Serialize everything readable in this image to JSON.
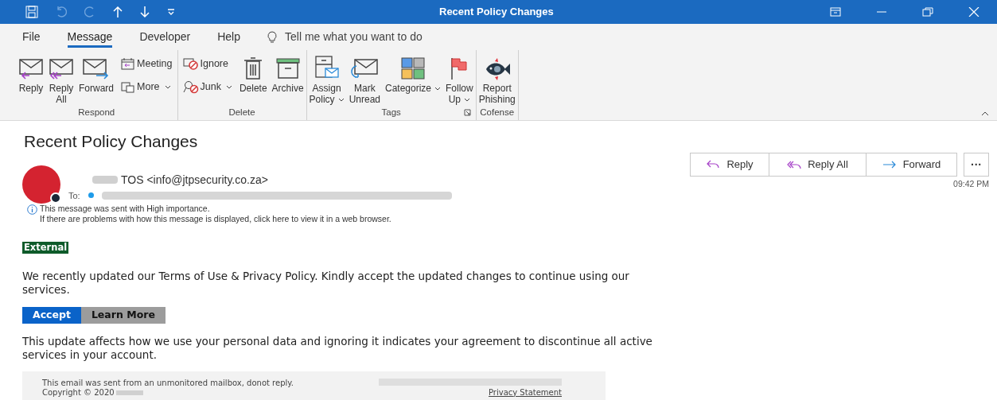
{
  "window": {
    "title": "Recent Policy Changes"
  },
  "menu_tabs": [
    {
      "label": "File",
      "selected": false
    },
    {
      "label": "Message",
      "selected": true
    },
    {
      "label": "Developer",
      "selected": false
    },
    {
      "label": "Help",
      "selected": false
    }
  ],
  "tell_me": {
    "placeholder": "Tell me what you want to do"
  },
  "ribbon_groups": [
    {
      "label": "Respond",
      "launcher": false,
      "buttons": [
        {
          "kind": "large",
          "label": "Reply",
          "dropdown": false
        },
        {
          "kind": "large",
          "label": "Reply\nAll",
          "dropdown": false
        },
        {
          "kind": "large",
          "label": "Forward",
          "dropdown": false
        },
        {
          "kind": "stack",
          "items": [
            {
              "label": "Meeting",
              "dropdown": false
            },
            {
              "label": "More",
              "dropdown": true
            }
          ]
        }
      ]
    },
    {
      "label": "Delete",
      "launcher": false,
      "buttons": [
        {
          "kind": "stack",
          "items": [
            {
              "label": "Ignore",
              "dropdown": false
            },
            {
              "label": "Junk",
              "dropdown": true
            }
          ]
        },
        {
          "kind": "large",
          "label": "Delete",
          "dropdown": false
        },
        {
          "kind": "large",
          "label": "Archive",
          "dropdown": false
        }
      ]
    },
    {
      "label": "Tags",
      "launcher": true,
      "buttons": [
        {
          "kind": "large",
          "label": "Assign\nPolicy",
          "dropdown": true
        },
        {
          "kind": "large",
          "label": "Mark\nUnread",
          "dropdown": false
        },
        {
          "kind": "large",
          "label": "Categorize",
          "dropdown": true
        },
        {
          "kind": "large",
          "label": "Follow\nUp",
          "dropdown": true
        }
      ]
    },
    {
      "label": "Cofense",
      "launcher": false,
      "buttons": [
        {
          "kind": "large",
          "label": "Report\nPhishing",
          "dropdown": false
        }
      ]
    }
  ],
  "message": {
    "subject": "Recent Policy Changes",
    "sender": "TOS <info@jtpsecurity.co.za>",
    "to_label": "To:",
    "notices": [
      "This message was sent with High importance.",
      "If there are problems with how this message is displayed, click here to view it in a web browser."
    ],
    "actions": [
      {
        "label": "Reply"
      },
      {
        "label": "Reply All"
      },
      {
        "label": "Forward"
      }
    ],
    "more": "···",
    "time": "09:42 PM"
  },
  "body": {
    "tag": "External",
    "paragraph_1": "We recently updated our Terms of Use & Privacy Policy. Kindly accept the updated changes to continue using our services.",
    "buttons": [
      {
        "label": "Accept",
        "kind": "primary"
      },
      {
        "label": "Learn More",
        "kind": "secondary"
      }
    ],
    "paragraph_2": "This update affects how we use your personal data and ignoring it indicates your agreement to discontinue all active services in your account.",
    "footer": {
      "notice": "This email was sent from an unmonitored mailbox, donot reply.",
      "copyright": "Copyright © 2020",
      "link": "Privacy Statement"
    }
  }
}
